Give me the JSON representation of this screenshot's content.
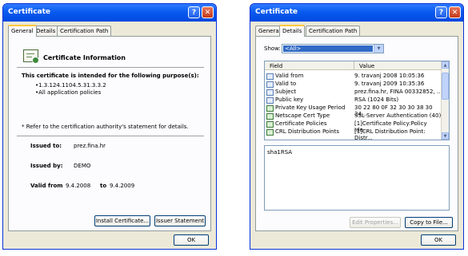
{
  "left_window": {
    "title": "Certificate",
    "help_glyph": "?",
    "close_glyph": "✕",
    "tabs": [
      "General",
      "Details",
      "Certification Path"
    ],
    "info_heading": "Certificate Information",
    "purpose_heading": "This certificate is intended for the following purpose(s):",
    "purposes": [
      "•1.3.124.1104.5.31.3.3.2",
      "•All application policies"
    ],
    "refer_note": "* Refer to the certification authority's statement for details.",
    "issued_to_label": "Issued to:",
    "issued_to_value": "prez.fina.hr",
    "issued_by_label": "Issued by:",
    "issued_by_value": "DEMO",
    "valid_from_label": "Valid from",
    "valid_from_value": "9.4.2008",
    "valid_to_label": "to",
    "valid_to_value": "9.4.2009",
    "install_button": "Install Certificate...",
    "issuer_button": "Issuer Statement",
    "ok_button": "OK"
  },
  "right_window": {
    "title": "Certificate",
    "help_glyph": "?",
    "close_glyph": "✕",
    "tabs": [
      "General",
      "Details",
      "Certification Path"
    ],
    "show_label": "Show:",
    "show_value": "<All>",
    "dropdown_glyph": "▼",
    "columns": [
      "Field",
      "Value"
    ],
    "rows": [
      {
        "field": "Valid from",
        "value": "9. travanj 2008 10:05:36",
        "icon": "field-icon"
      },
      {
        "field": "Valid to",
        "value": "9. travanj 2009 10:35:36",
        "icon": "field-icon"
      },
      {
        "field": "Subject",
        "value": "prez.fina.hr, FINA 00332852, ...",
        "icon": "field-icon"
      },
      {
        "field": "Public key",
        "value": "RSA (1024 Bits)",
        "icon": "field-icon"
      },
      {
        "field": "Private Key Usage Period",
        "value": "30 22 80 0F 32 30 30 38 30 34...",
        "icon": "extension-icon"
      },
      {
        "field": "Netscape Cert Type",
        "value": "SSL Server Authentication (40)",
        "icon": "extension-icon"
      },
      {
        "field": "Certificate Policies",
        "value": "[1]Certificate Policy:Policy Ide...",
        "icon": "extension-icon"
      },
      {
        "field": "CRL Distribution Points",
        "value": "[1]CRL Distribution Point: Distr...",
        "icon": "extension-icon"
      }
    ],
    "detail_text": "sha1RSA",
    "edit_button": "Edit Properties...",
    "copy_button": "Copy to File...",
    "ok_button": "OK",
    "scroll_up_glyph": "▲",
    "scroll_down_glyph": "▼"
  }
}
